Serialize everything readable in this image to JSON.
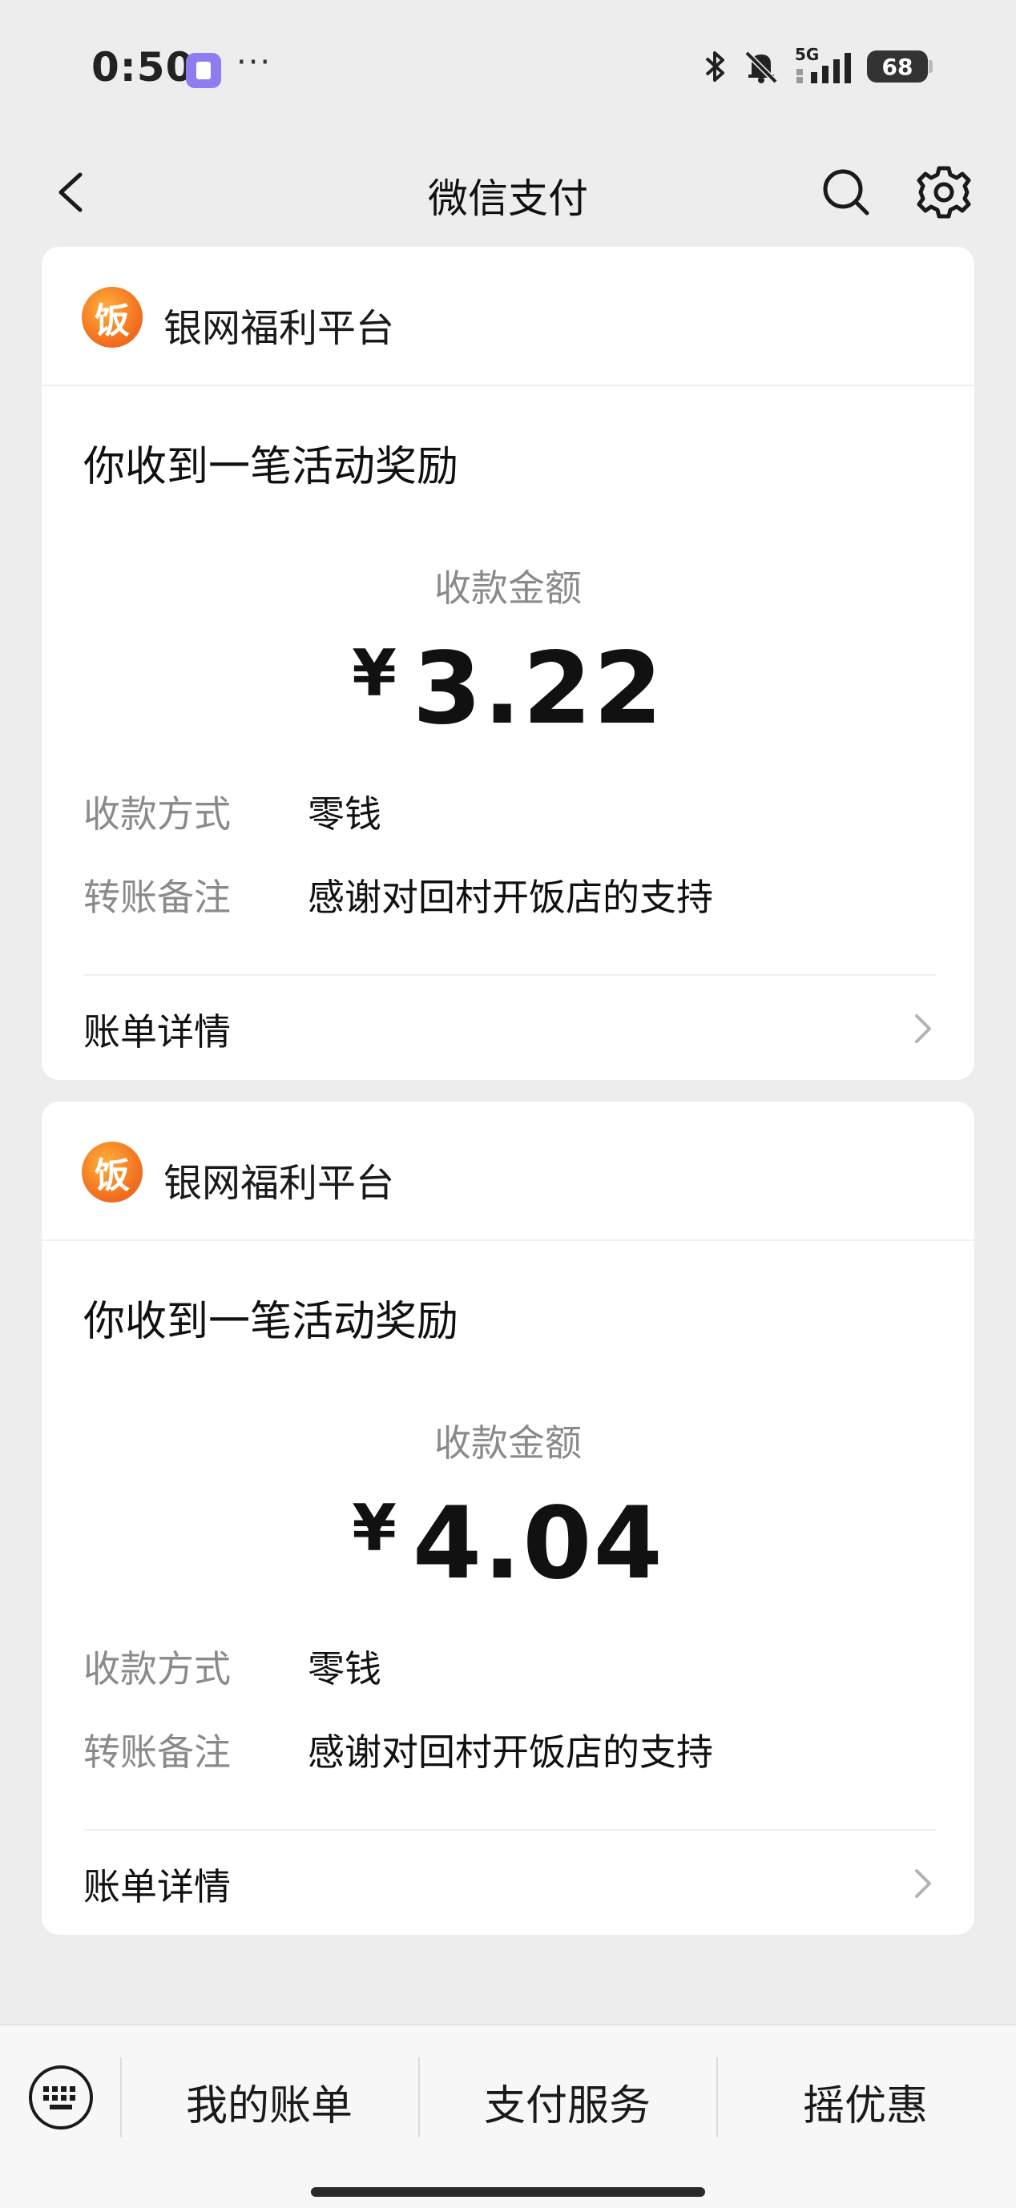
{
  "status_bar": {
    "time": "0:50",
    "dots": "···",
    "network": "5G",
    "battery": "68"
  },
  "nav": {
    "title": "微信支付"
  },
  "messages": [
    {
      "logo_char": "饭",
      "platform": "银网福利平台",
      "title": "你收到一笔活动奖励",
      "amount_label": "收款金额",
      "currency": "¥",
      "amount": "3.22",
      "method_label": "收款方式",
      "method_value": "零钱",
      "note_label": "转账备注",
      "note_value": "感谢对回村开饭店的支持",
      "bill_label": "账单详情"
    },
    {
      "logo_char": "饭",
      "platform": "银网福利平台",
      "title": "你收到一笔活动奖励",
      "amount_label": "收款金额",
      "currency": "¥",
      "amount": "4.04",
      "method_label": "收款方式",
      "method_value": "零钱",
      "note_label": "转账备注",
      "note_value": "感谢对回村开饭店的支持",
      "bill_label": "账单详情"
    }
  ],
  "bottom_menu": {
    "items": [
      "我的账单",
      "支付服务",
      "摇优惠"
    ]
  },
  "icons": [
    "back-icon",
    "search-icon",
    "gear-icon",
    "chevron-right-icon",
    "keyboard-icon",
    "bluetooth-icon",
    "mute-icon",
    "signal-icon",
    "battery-icon"
  ]
}
